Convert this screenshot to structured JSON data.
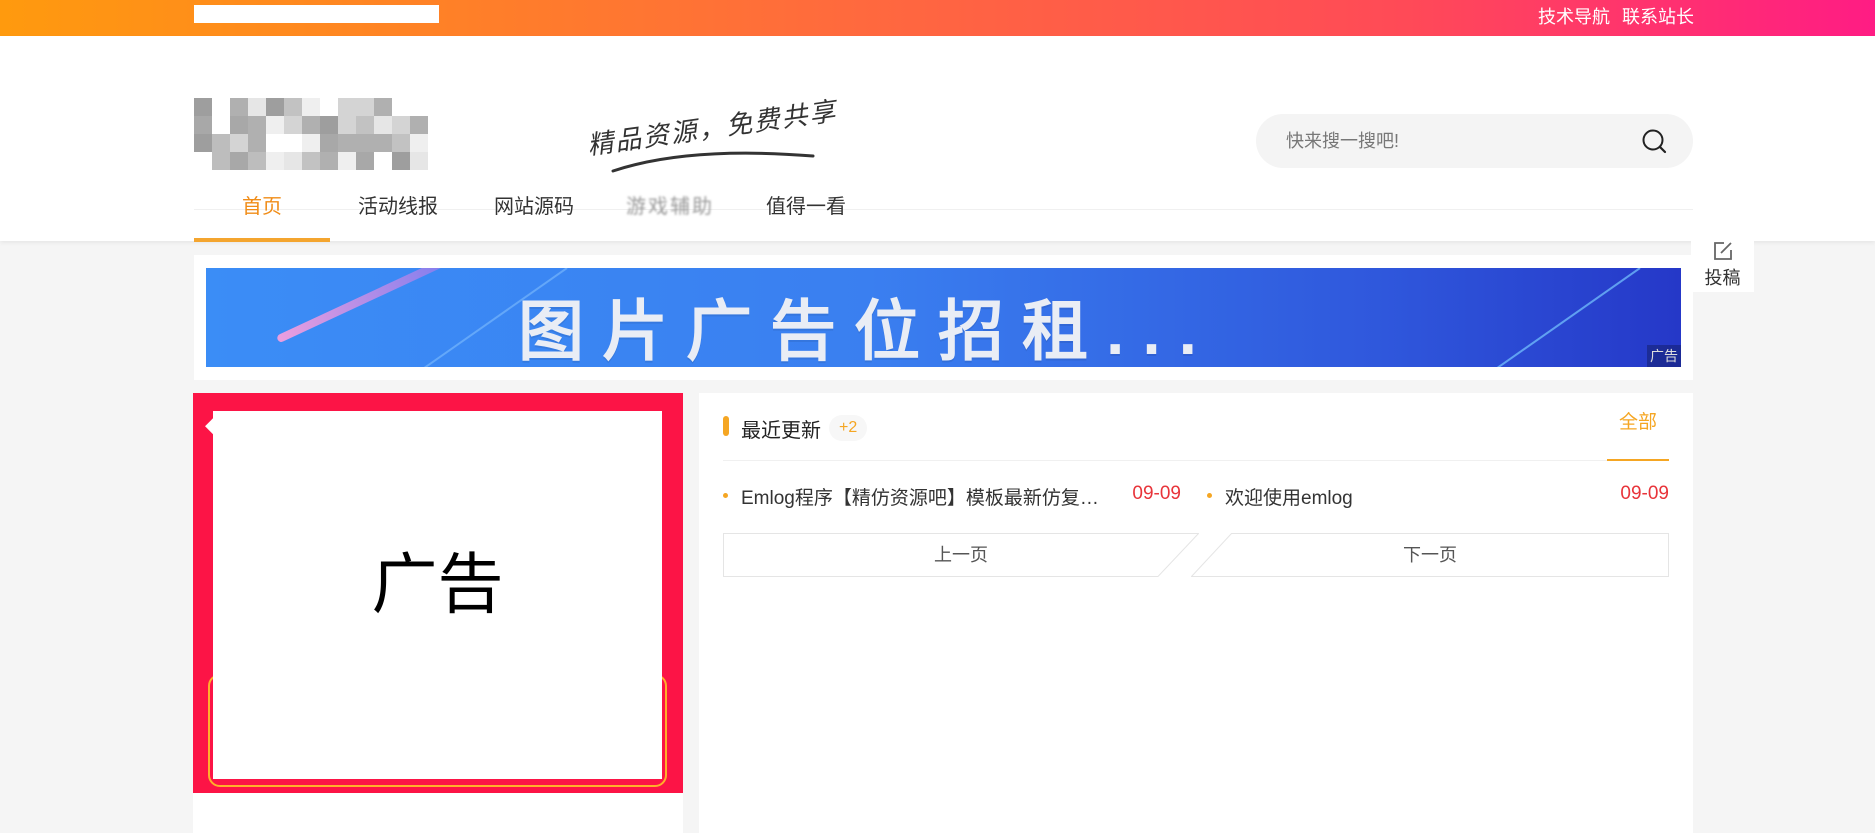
{
  "topbar": {
    "links": [
      "技术导航",
      "联系站长"
    ]
  },
  "header": {
    "slogan": "精品资源，免费共享",
    "search_placeholder": "快来搜一搜吧!"
  },
  "nav": {
    "items": [
      {
        "label": "首页",
        "active": true
      },
      {
        "label": "活动线报"
      },
      {
        "label": "网站源码"
      },
      {
        "label": "游戏辅助"
      },
      {
        "label": "值得一看"
      }
    ]
  },
  "side": {
    "submit_label": "投稿"
  },
  "banner": {
    "text": "图片广告位招租...",
    "ad_tag": "广告"
  },
  "left_ad": {
    "label": "广告"
  },
  "recent": {
    "title": "最近更新",
    "badge": "+2",
    "all_label": "全部",
    "posts": [
      {
        "title": "Emlog程序【精仿资源吧】模板最新仿复版【...",
        "date": "09-09"
      },
      {
        "title": "欢迎使用emlog",
        "date": "09-09"
      }
    ],
    "prev_label": "上一页",
    "next_label": "下一页"
  },
  "colors": {
    "accent": "#f5a623",
    "date": "#e8343a",
    "left_ad_bg": "#fc1446"
  }
}
